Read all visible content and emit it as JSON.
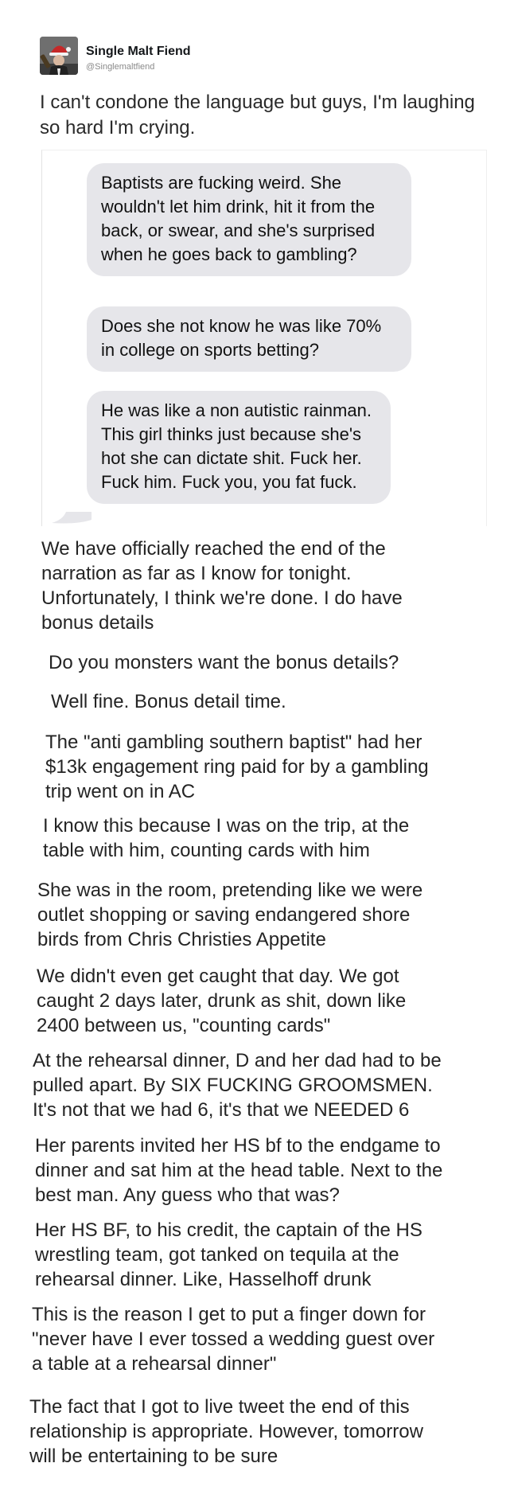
{
  "author": {
    "name": "Single Malt Fiend",
    "handle": "@Singlemaltfiend",
    "avatar_icon": "santa-hat-man-drinking-avatar"
  },
  "tweet": {
    "text": "I can't condone the language but guys, I'm laughing so hard I'm crying."
  },
  "imessage": {
    "bubble_color": "#e6e6ea",
    "bubbles": [
      "Baptists are fucking weird. She wouldn't let him drink, hit it from the back, or swear, and she's surprised when he goes back to gambling?",
      "Does she not know he was like 70% in college on sports betting?",
      "He was like a non autistic rainman. This girl thinks just because she's hot she can dictate shit. Fuck her. Fuck him. Fuck you, you fat fuck."
    ]
  },
  "thread": [
    "We have officially reached the end of the\nnarration as far as I know for tonight.\nUnfortunately, I think we're done. I do have\nbonus details",
    "Do you monsters want the bonus details?",
    "Well fine. Bonus detail time.",
    "The \"anti gambling southern baptist\" had her\n$13k engagement ring paid for by a gambling\ntrip went on in AC",
    "I know this because I was on the trip, at the\ntable with him, counting cards with him",
    "She was in the room, pretending like we were\noutlet shopping or saving endangered shore\nbirds from Chris Christies Appetite",
    "We didn't even get caught that day. We got\ncaught 2 days later, drunk as shit, down like\n2400 between us, \"counting cards\"",
    "At the rehearsal dinner, D and her dad had to be\npulled apart. By SIX FUCKING GROOMSMEN.\nIt's not that we had 6, it's that we NEEDED 6",
    "Her parents invited her HS bf to the endgame to\ndinner and sat him at the head table. Next to the\nbest man. Any guess who that was?",
    "Her HS BF, to his credit, the captain of the HS\nwrestling team, got tanked on tequila at the\nrehearsal dinner. Like, Hasselhoff drunk",
    "This is the reason I get to put a finger down for\n\"never have I ever tossed a wedding guest over\na table at a rehearsal dinner\"",
    "The fact that I got to live tweet the end of this\nrelationship is appropriate. However, tomorrow\nwill be entertaining to be sure"
  ]
}
